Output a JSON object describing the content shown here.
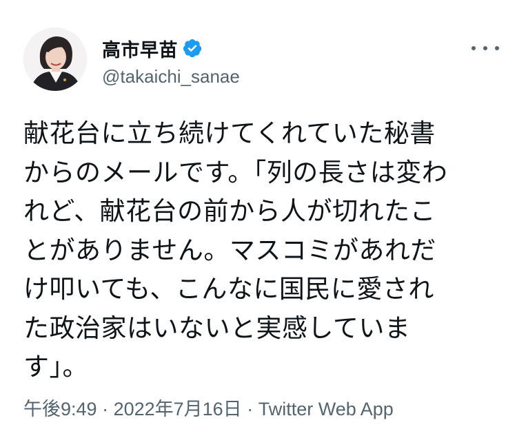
{
  "user": {
    "display_name": "高市早苗",
    "handle": "@takaichi_sanae",
    "verified_icon": "verified-badge-icon",
    "avatar_icon": "avatar"
  },
  "tweet": {
    "text": "献花台に立ち続けてくれていた秘書\nからのメールです。「列の長さは変わ\nれど、献花台の前から人が切れたこ\nとがありません。マスコミがあれだ\nけ叩いても、こんなに国民に愛され\nた政治家はいないと実感していま\nす」。",
    "time": "午後9:49",
    "separator": " · ",
    "date": "2022年7月16日",
    "source": "Twitter Web App"
  },
  "colors": {
    "text": "#0f1419",
    "secondary": "#536471",
    "verified": "#1d9bf0",
    "background": "#ffffff"
  }
}
